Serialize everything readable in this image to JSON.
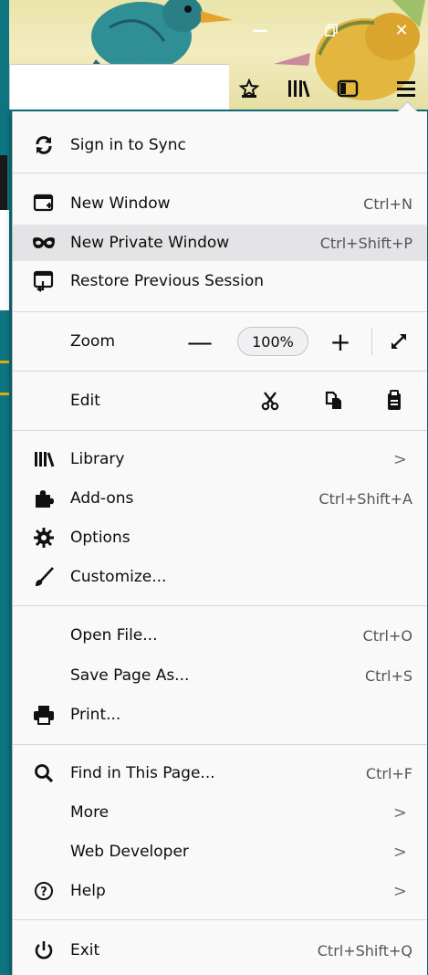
{
  "window": {
    "minimize_icon": "minimize-icon",
    "restore_icon": "restore-icon",
    "close_icon": "close-icon"
  },
  "toolbar": {
    "icons": [
      "bookmarks-star-icon",
      "library-icon",
      "sidebar-icon",
      "hamburger-menu-icon"
    ]
  },
  "menu": {
    "sync": {
      "label": "Sign in to Sync",
      "icon": "sync-icon"
    },
    "new_window": {
      "label": "New Window",
      "shortcut": "Ctrl+N",
      "icon": "new-window-icon"
    },
    "private_window": {
      "label": "New Private Window",
      "shortcut": "Ctrl+Shift+P",
      "icon": "private-mask-icon"
    },
    "restore": {
      "label": "Restore Previous Session",
      "icon": "restore-session-icon"
    },
    "zoom": {
      "label": "Zoom",
      "minus": "—",
      "value": "100%",
      "plus": "+"
    },
    "edit": {
      "label": "Edit",
      "icons": [
        "cut-icon",
        "copy-icon",
        "paste-icon"
      ]
    },
    "library": {
      "label": "Library",
      "chevron": ">",
      "icon": "library-icon"
    },
    "addons": {
      "label": "Add-ons",
      "shortcut": "Ctrl+Shift+A",
      "icon": "puzzle-icon"
    },
    "options": {
      "label": "Options",
      "icon": "gear-icon"
    },
    "customize": {
      "label": "Customize...",
      "icon": "paintbrush-icon"
    },
    "open_file": {
      "label": "Open File...",
      "shortcut": "Ctrl+O"
    },
    "save_page": {
      "label": "Save Page As...",
      "shortcut": "Ctrl+S"
    },
    "print": {
      "label": "Print...",
      "icon": "printer-icon"
    },
    "find": {
      "label": "Find in This Page...",
      "shortcut": "Ctrl+F",
      "icon": "search-icon"
    },
    "more": {
      "label": "More",
      "chevron": ">"
    },
    "web_dev": {
      "label": "Web Developer",
      "chevron": ">"
    },
    "help": {
      "label": "Help",
      "chevron": ">",
      "icon": "help-icon"
    },
    "exit": {
      "label": "Exit",
      "shortcut": "Ctrl+Shift+Q",
      "icon": "power-icon"
    }
  },
  "colors": {
    "menu_bg": "#f9f9fa",
    "hover_bg": "#e4e4e6",
    "separator": "#d7d7db",
    "frame_teal": "#0b6f7a"
  }
}
